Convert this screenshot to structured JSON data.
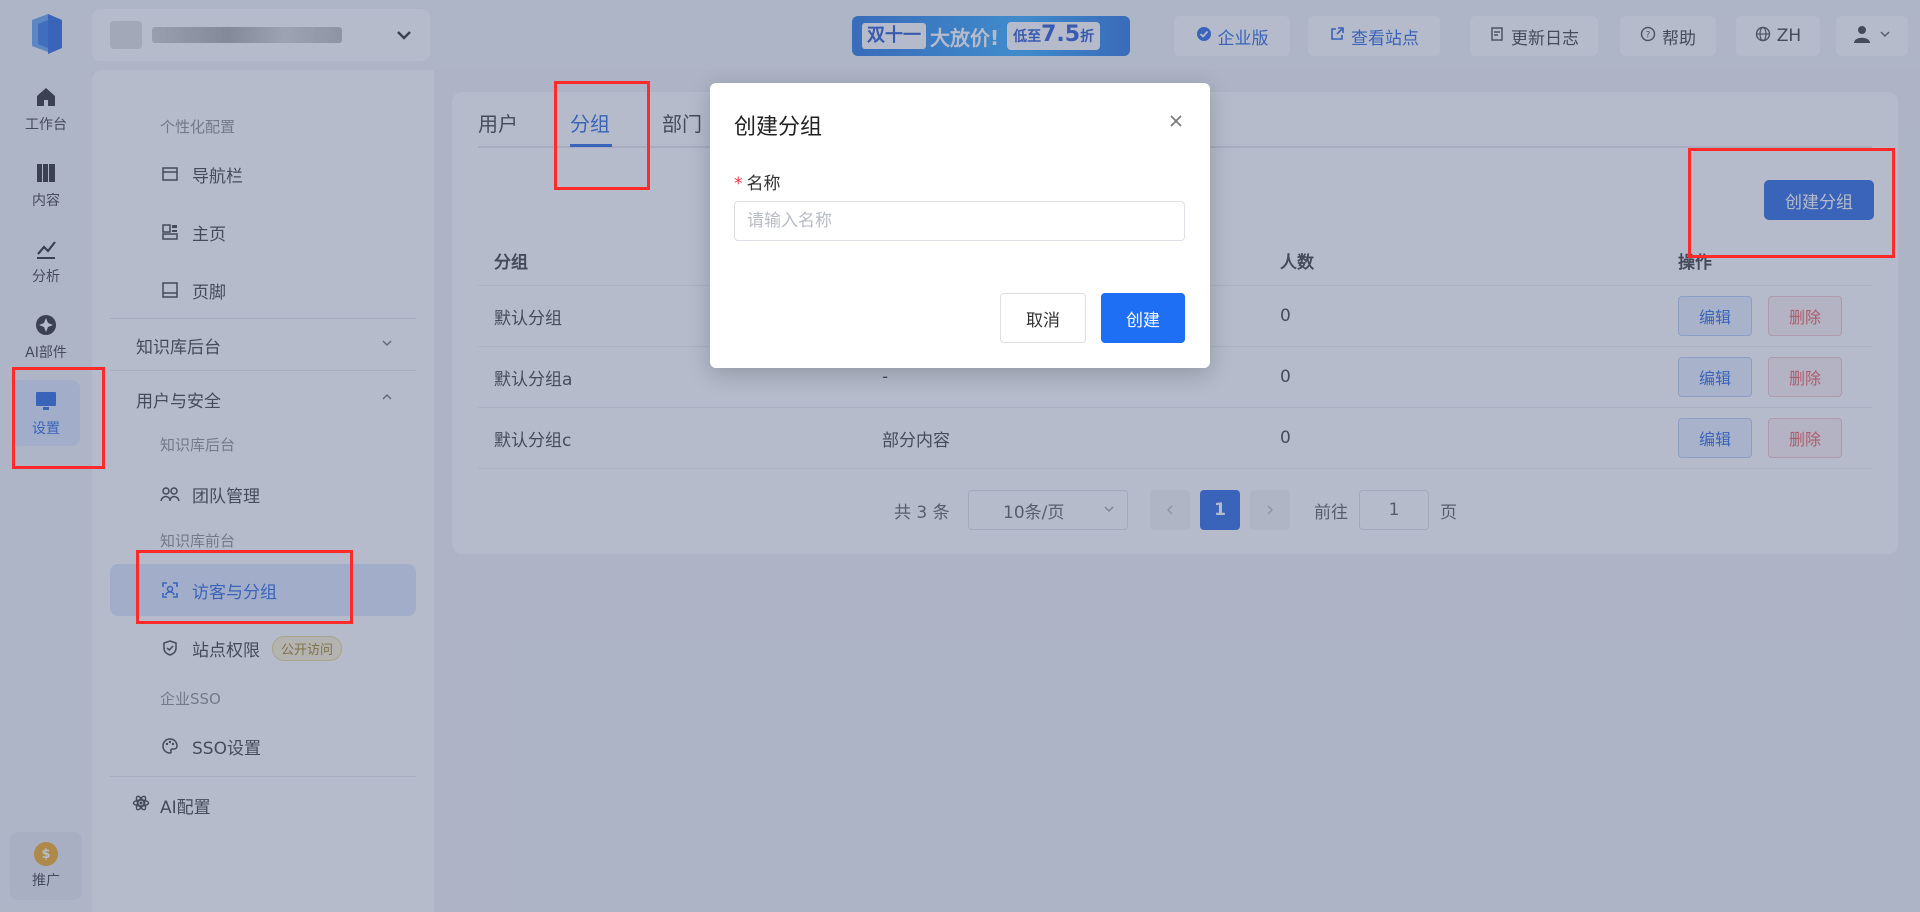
{
  "rail": {
    "items": [
      {
        "label": "工作台",
        "icon": "home-icon"
      },
      {
        "label": "内容",
        "icon": "book-icon"
      },
      {
        "label": "分析",
        "icon": "chart-icon"
      },
      {
        "label": "AI部件",
        "icon": "ai-component-icon"
      },
      {
        "label": "设置",
        "icon": "monitor-icon"
      }
    ],
    "promo_label": "推广",
    "promo_coin": "$"
  },
  "topbar": {
    "banner": {
      "tag": "双十一",
      "text": "大放价!",
      "price_prefix": "低至",
      "price": "7.5",
      "price_suffix": "折"
    },
    "enterprise": "企业版",
    "view_site": "查看站点",
    "changelog": "更新日志",
    "help": "帮助",
    "lang": "ZH"
  },
  "menu": {
    "personalize_group": "个性化配置",
    "navbar": "导航栏",
    "homepage": "主页",
    "footer": "页脚",
    "kb_backend": "知识库后台",
    "user_security": "用户与安全",
    "kb_backend_group": "知识库后台",
    "team_mgmt": "团队管理",
    "kb_frontend_group": "知识库前台",
    "visitor_group": "访客与分组",
    "site_permission": "站点权限",
    "public_badge": "公开访问",
    "sso_group": "企业SSO",
    "sso_settings": "SSO设置",
    "ai_config": "AI配置"
  },
  "tabs": [
    "用户",
    "分组",
    "部门"
  ],
  "create_group_button": "创建分组",
  "table": {
    "headers": [
      "分组",
      "",
      "人数",
      "操作"
    ],
    "rows": [
      {
        "name": "默认分组",
        "desc": "",
        "count": "0"
      },
      {
        "name": "默认分组a",
        "desc": "-",
        "count": "0"
      },
      {
        "name": "默认分组c",
        "desc": "部分内容",
        "count": "0"
      }
    ],
    "edit_label": "编辑",
    "delete_label": "删除"
  },
  "pager": {
    "total": "共 3 条",
    "page_size": "10条/页",
    "current": "1",
    "goto": "前往",
    "goto_value": "1",
    "page_unit": "页"
  },
  "modal": {
    "title": "创建分组",
    "required_mark": "*",
    "name_label": "名称",
    "name_placeholder": "请输入名称",
    "cancel": "取消",
    "confirm": "创建"
  },
  "colors": {
    "primary": "#1f5fe0",
    "danger": "#ee5555",
    "annotation": "#ff2a2a"
  }
}
